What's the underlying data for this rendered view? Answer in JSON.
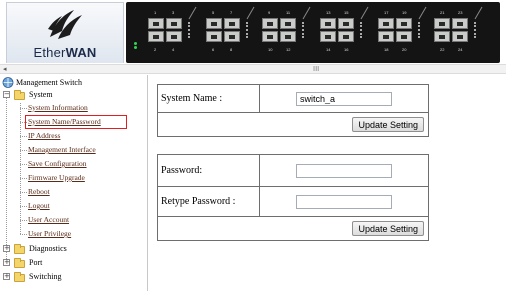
{
  "brand": {
    "name_prefix": "Ether",
    "name_suffix": "WAN",
    "logo_icon": "etherwan-swoosh-icon"
  },
  "panel": {
    "top_numbers": [
      "1",
      "3",
      "5",
      "7",
      "9",
      "11",
      "13",
      "15",
      "17",
      "19",
      "21",
      "23"
    ],
    "bottom_numbers": [
      "2",
      "4",
      "6",
      "8",
      "10",
      "12",
      "14",
      "16",
      "18",
      "20",
      "22",
      "24"
    ],
    "led_color": "#2fd64e"
  },
  "scroll": {
    "left_arrow": "◂",
    "grip": "III"
  },
  "sidebar": {
    "root": "Management Switch",
    "system": {
      "label": "System",
      "items": [
        "System Information",
        "System Name/Password",
        "IP Address",
        "Management Interface",
        "Save Configuration",
        "Firmware Upgrade",
        "Reboot",
        "Logout",
        "User Account",
        "User Privilege"
      ],
      "selected_index": 1
    },
    "folders": [
      "Diagnostics",
      "Port",
      "Switching"
    ],
    "expand_minus": "−",
    "expand_plus": "+",
    "highlight_color": "#e02020"
  },
  "main": {
    "name_form": {
      "label": "System Name :",
      "value": "switch_a",
      "button": "Update Setting"
    },
    "password_form": {
      "password_label": "Password:",
      "retype_label": "Retype Password :",
      "password_value": "",
      "retype_value": "",
      "button": "Update Setting"
    }
  }
}
